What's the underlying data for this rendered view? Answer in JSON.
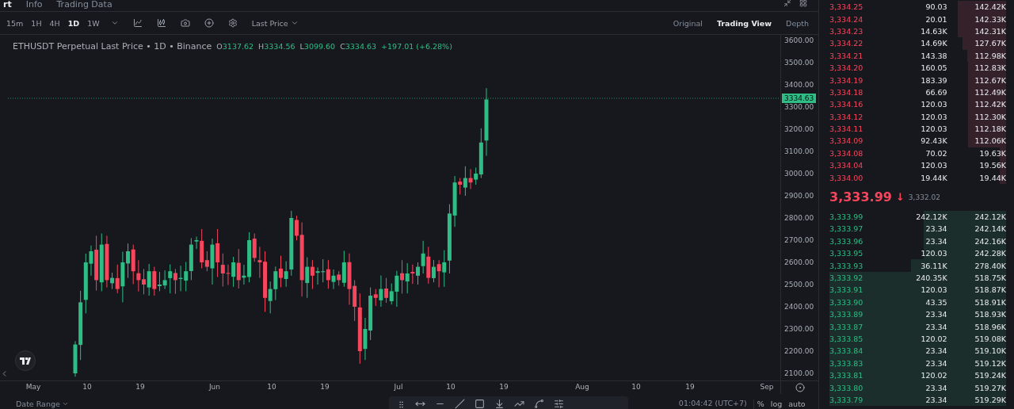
{
  "top_tabs": [
    {
      "label": "rt",
      "selected": true
    },
    {
      "label": "Info",
      "selected": false
    },
    {
      "label": "Trading Data",
      "selected": false
    }
  ],
  "intervals": [
    {
      "label": "15m",
      "selected": false
    },
    {
      "label": "1H",
      "selected": false
    },
    {
      "label": "4H",
      "selected": false
    },
    {
      "label": "1D",
      "selected": true
    },
    {
      "label": "1W",
      "selected": false
    }
  ],
  "price_source": "Last Price",
  "views": [
    {
      "label": "Original",
      "selected": false
    },
    {
      "label": "Trading View",
      "selected": true
    },
    {
      "label": "Depth",
      "selected": false
    }
  ],
  "chart": {
    "title": "ETHUSDT Perpetual Last Price • 1D • Binance",
    "ohlc": [
      {
        "key": "O",
        "value": "3137.62"
      },
      {
        "key": "H",
        "value": "3334.56"
      },
      {
        "key": "L",
        "value": "3099.60"
      },
      {
        "key": "C",
        "value": "3334.63"
      }
    ],
    "change": "+197.01 (+6.28%)",
    "last_price_tag": "3334.63",
    "price_ticks": [
      "3600.00",
      "3500.00",
      "3400.00",
      "3300.00",
      "3200.00",
      "3100.00",
      "3000.00",
      "2900.00",
      "2800.00",
      "2700.00",
      "2600.00",
      "2500.00",
      "2400.00",
      "2300.00",
      "2200.00",
      "2100.00"
    ],
    "date_ticks": [
      "May",
      "10",
      "19",
      "Jun",
      "10",
      "19",
      "Jul",
      "10",
      "19",
      "Aug",
      "10",
      "19",
      "Sep"
    ]
  },
  "footer": {
    "date_range": "Date Range",
    "clock": "01:04:42 (UTC+7)",
    "scale_options": [
      "%",
      "log",
      "auto"
    ]
  },
  "orderbook": {
    "asks": [
      {
        "price": "3,334.25",
        "amount": "90.03",
        "total": "142.42K"
      },
      {
        "price": "3,334.24",
        "amount": "20.01",
        "total": "142.33K"
      },
      {
        "price": "3,334.23",
        "amount": "14.63K",
        "total": "142.31K"
      },
      {
        "price": "3,334.22",
        "amount": "14.69K",
        "total": "127.67K"
      },
      {
        "price": "3,334.21",
        "amount": "143.38",
        "total": "112.98K"
      },
      {
        "price": "3,334.20",
        "amount": "160.05",
        "total": "112.83K"
      },
      {
        "price": "3,334.19",
        "amount": "183.39",
        "total": "112.67K"
      },
      {
        "price": "3,334.18",
        "amount": "66.69",
        "total": "112.49K"
      },
      {
        "price": "3,334.16",
        "amount": "120.03",
        "total": "112.42K"
      },
      {
        "price": "3,334.12",
        "amount": "120.03",
        "total": "112.30K"
      },
      {
        "price": "3,334.11",
        "amount": "120.03",
        "total": "112.18K"
      },
      {
        "price": "3,334.09",
        "amount": "92.43K",
        "total": "112.06K"
      },
      {
        "price": "3,334.08",
        "amount": "70.02",
        "total": "19.63K"
      },
      {
        "price": "3,334.04",
        "amount": "120.03",
        "total": "19.56K"
      },
      {
        "price": "3,334.00",
        "amount": "19.44K",
        "total": "19.44K"
      }
    ],
    "mid": {
      "price": "3,333.99",
      "arrow": "↓",
      "mark_price": "3,332.02"
    },
    "bids": [
      {
        "price": "3,333.99",
        "amount": "242.12K",
        "total": "242.12K"
      },
      {
        "price": "3,333.97",
        "amount": "23.34",
        "total": "242.14K"
      },
      {
        "price": "3,333.96",
        "amount": "23.34",
        "total": "242.16K"
      },
      {
        "price": "3,333.95",
        "amount": "120.03",
        "total": "242.28K"
      },
      {
        "price": "3,333.93",
        "amount": "36.11K",
        "total": "278.40K"
      },
      {
        "price": "3,333.92",
        "amount": "240.35K",
        "total": "518.75K"
      },
      {
        "price": "3,333.91",
        "amount": "120.03",
        "total": "518.87K"
      },
      {
        "price": "3,333.90",
        "amount": "43.35",
        "total": "518.91K"
      },
      {
        "price": "3,333.89",
        "amount": "23.34",
        "total": "518.93K"
      },
      {
        "price": "3,333.87",
        "amount": "23.34",
        "total": "518.96K"
      },
      {
        "price": "3,333.85",
        "amount": "120.02",
        "total": "519.08K"
      },
      {
        "price": "3,333.84",
        "amount": "23.34",
        "total": "519.10K"
      },
      {
        "price": "3,333.83",
        "amount": "23.34",
        "total": "519.12K"
      },
      {
        "price": "3,333.81",
        "amount": "120.02",
        "total": "519.24K"
      },
      {
        "price": "3,333.80",
        "amount": "23.34",
        "total": "519.27K"
      },
      {
        "price": "3,333.79",
        "amount": "23.34",
        "total": "519.29K"
      }
    ]
  }
}
